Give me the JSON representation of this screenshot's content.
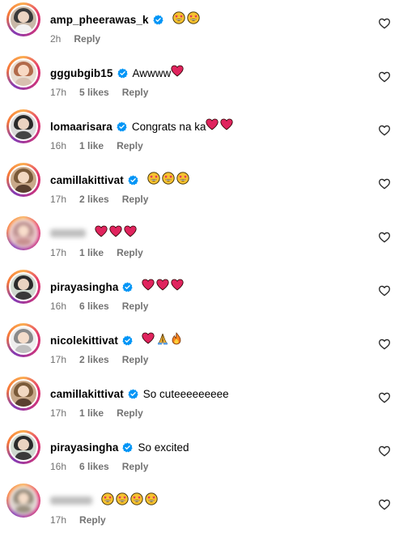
{
  "colors": {
    "verified_blue": "#0095f6",
    "meta_text": "#737373",
    "heart_red": "#e0245e"
  },
  "comments": [
    {
      "username": "amp_pheerawas_k",
      "verified": true,
      "text": "",
      "emojis": [
        "star-eyes",
        "star-eyes"
      ],
      "time": "2h",
      "likes": "",
      "reply": "Reply",
      "avatar_colors": [
        "#c8b8a8",
        "#3a3a3a",
        "#f2f2f2"
      ]
    },
    {
      "username": "gggubgib15",
      "verified": true,
      "text": "Awwww",
      "emojis": [
        "heart"
      ],
      "time": "17h",
      "likes": "5 likes",
      "reply": "Reply",
      "avatar_colors": [
        "#e9dcd0",
        "#b26a4a",
        "#d8c0b0"
      ]
    },
    {
      "username": "lomaarisara",
      "verified": true,
      "text": "Congrats na ka",
      "emojis": [
        "heart",
        "heart"
      ],
      "time": "16h",
      "likes": "1 like",
      "reply": "Reply",
      "avatar_colors": [
        "#d9d9d9",
        "#2a2a2a",
        "#444444"
      ]
    },
    {
      "username": "camillakittivat",
      "verified": true,
      "text": "",
      "emojis": [
        "star-eyes",
        "star-eyes",
        "star-eyes"
      ],
      "time": "17h",
      "likes": "2 likes",
      "reply": "Reply",
      "avatar_colors": [
        "#c9a98a",
        "#7a5a3a",
        "#5a4030"
      ]
    },
    {
      "username": "",
      "username_blurred": true,
      "verified": false,
      "text": "",
      "emojis": [
        "heart",
        "heart",
        "heart"
      ],
      "time": "17h",
      "likes": "1 like",
      "reply": "Reply",
      "avatar_colors": [
        "#e0b8b8",
        "#b78b8b",
        "#c89090"
      ]
    },
    {
      "username": "pirayasingha",
      "verified": true,
      "text": "",
      "emojis": [
        "heart",
        "heart",
        "heart"
      ],
      "time": "16h",
      "likes": "6 likes",
      "reply": "Reply",
      "avatar_colors": [
        "#cfd8cf",
        "#2b2b2b",
        "#3a3a3a"
      ]
    },
    {
      "username": "nicolekittivat",
      "verified": true,
      "text": "",
      "emojis": [
        "heart",
        "pray",
        "fire"
      ],
      "time": "17h",
      "likes": "2 likes",
      "reply": "Reply",
      "avatar_colors": [
        "#eeeeee",
        "#8a8a8a",
        "#bfbfbf"
      ]
    },
    {
      "username": "camillakittivat",
      "verified": true,
      "text": "So cuteeeeeeeee",
      "emojis": [],
      "time": "17h",
      "likes": "1 like",
      "reply": "Reply",
      "avatar_colors": [
        "#c9a98a",
        "#7a5a3a",
        "#5a4030"
      ]
    },
    {
      "username": "pirayasingha",
      "verified": true,
      "text": "So excited",
      "emojis": [],
      "time": "16h",
      "likes": "6 likes",
      "reply": "Reply",
      "avatar_colors": [
        "#cfd8cf",
        "#2b2b2b",
        "#3a3a3a"
      ]
    },
    {
      "username": "",
      "username_blurred": true,
      "verified": false,
      "text": "",
      "emojis": [
        "star-eyes",
        "star-eyes",
        "star-eyes",
        "star-eyes"
      ],
      "time": "17h",
      "likes": "",
      "reply": "Reply",
      "avatar_colors": [
        "#d8d0c8",
        "#8a8070",
        "#9a9080"
      ]
    }
  ]
}
